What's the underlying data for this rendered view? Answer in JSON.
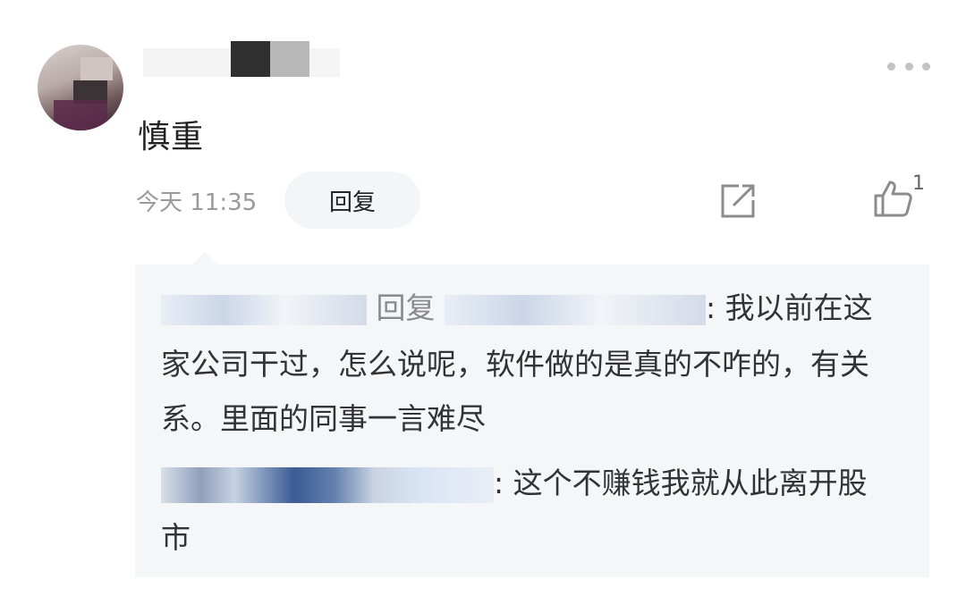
{
  "comment": {
    "text": "慎重",
    "time": "今天 11:35",
    "reply_label": "回复",
    "like_count": "1"
  },
  "replies": {
    "first": {
      "reply_word": "回复",
      "colon": ":",
      "line1_text": "我以前在这",
      "line2_text": "家公司干过，怎么说呢，软件做的是真的不咋的，有关",
      "line3_text": "系。里面的同事一言难尽"
    },
    "second": {
      "colon": ":",
      "line1_text": "这个不赚钱我就从此离开股",
      "line2_text": "市"
    }
  },
  "colors": {
    "reply_background": "#f5f6f8",
    "muted_text": "#9a9a9a",
    "body_text": "#333333"
  },
  "icons": [
    "more-icon",
    "share-icon",
    "thumbs-up-icon"
  ]
}
